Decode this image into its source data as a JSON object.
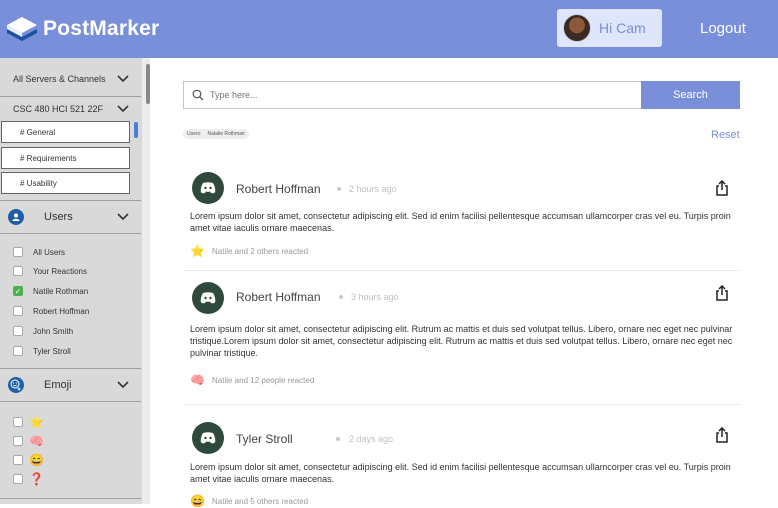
{
  "header": {
    "app_name": "PostMarker",
    "user_greeting": "Hi Cam",
    "logout_label": "Logout"
  },
  "sidebar": {
    "servers_label": "All Servers & Channels",
    "server_name": "CSC 480 HCI 521 22F",
    "channels": [
      "# General",
      "# Requirements",
      "# Usability"
    ],
    "users_section": {
      "label": "Users",
      "items": [
        {
          "label": "All Users",
          "checked": false
        },
        {
          "label": "Your Reactions",
          "checked": false
        },
        {
          "label": "Natile Rothman",
          "checked": true
        },
        {
          "label": "Robert Hoffman",
          "checked": false
        },
        {
          "label": "John Smith",
          "checked": false
        },
        {
          "label": "Tyler Stroll",
          "checked": false
        }
      ]
    },
    "emoji_section": {
      "label": "Emoji",
      "items": [
        {
          "emoji": "⭐",
          "checked": false
        },
        {
          "emoji": "🧠",
          "checked": false
        },
        {
          "emoji": "😄",
          "checked": false
        },
        {
          "emoji": "❓",
          "checked": false
        }
      ]
    }
  },
  "search": {
    "placeholder": "Type here...",
    "button_label": "Search"
  },
  "filter": {
    "key": "Users:",
    "value": "Natalie Rothman",
    "reset_label": "Reset"
  },
  "posts": [
    {
      "author": "Robert Hoffman",
      "time": "2 hours ago",
      "body": "Lorem ipsum dolor sit amet, consectetur adipiscing elit. Sed id enim facilisi pellentesque accumsan ullamcorper cras vel eu. Turpis proin amet vitae iaculis ornare maecenas.",
      "reaction_emoji": "⭐",
      "reaction_text": "Natile and 2 others reacted"
    },
    {
      "author": "Robert Hoffman",
      "time": "3 hours ago",
      "body": "Lorem ipsum dolor sit amet, consectetur adipiscing elit. Rutrum ac mattis et duis sed volutpat tellus. Libero, ornare nec eget nec pulvinar tristique.Lorem ipsum dolor sit amet, consectetur adipiscing elit. Rutrum ac mattis et duis sed volutpat tellus. Libero, ornare nec eget nec pulvinar tristique.",
      "reaction_emoji": "🧠",
      "reaction_text": "Natile and 12 people reacted"
    },
    {
      "author": "Tyler Stroll",
      "time": "2 days ago",
      "body": "Lorem ipsum dolor sit amet, consectetur adipiscing elit. Sed id enim facilisi pellentesque accumsan ullamcorper cras vel eu. Turpis proin amet vitae iaculis ornare maecenas.",
      "reaction_emoji": "😄",
      "reaction_text": "Natile and 5 others reacted"
    }
  ],
  "colors": {
    "brand": "#7a8fd9",
    "user_bg": "#dfe5fb",
    "sidebar_bg": "#d9d9d9",
    "avatar_green": "#2f4a3c",
    "checked_green": "#4caf50"
  }
}
